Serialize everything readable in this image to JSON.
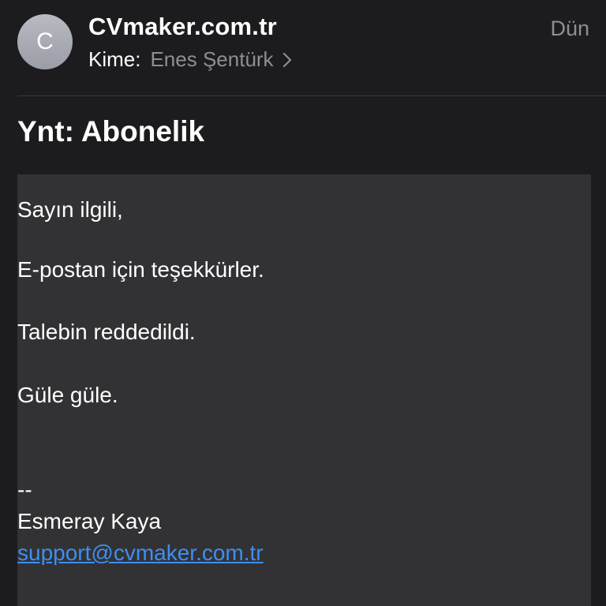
{
  "header": {
    "avatar_initial": "C",
    "sender": "CVmaker.com.tr",
    "date": "Dün",
    "to_label": "Kime:",
    "recipient": "Enes Şentürk"
  },
  "subject": "Ynt: Abonelik",
  "body": {
    "greeting": "Sayın ilgili,",
    "line2": "E-postan için teşekkürler.",
    "line3": "Talebin reddedildi.",
    "line4": "Güle güle.",
    "signature_separator": "--",
    "signature_name": "Esmeray Kaya",
    "signature_email": "support@cvmaker.com.tr"
  },
  "colors": {
    "background": "#1c1c1e",
    "body_background": "#323234",
    "secondary_text": "#8e8e93",
    "link": "#3d8ef0"
  }
}
